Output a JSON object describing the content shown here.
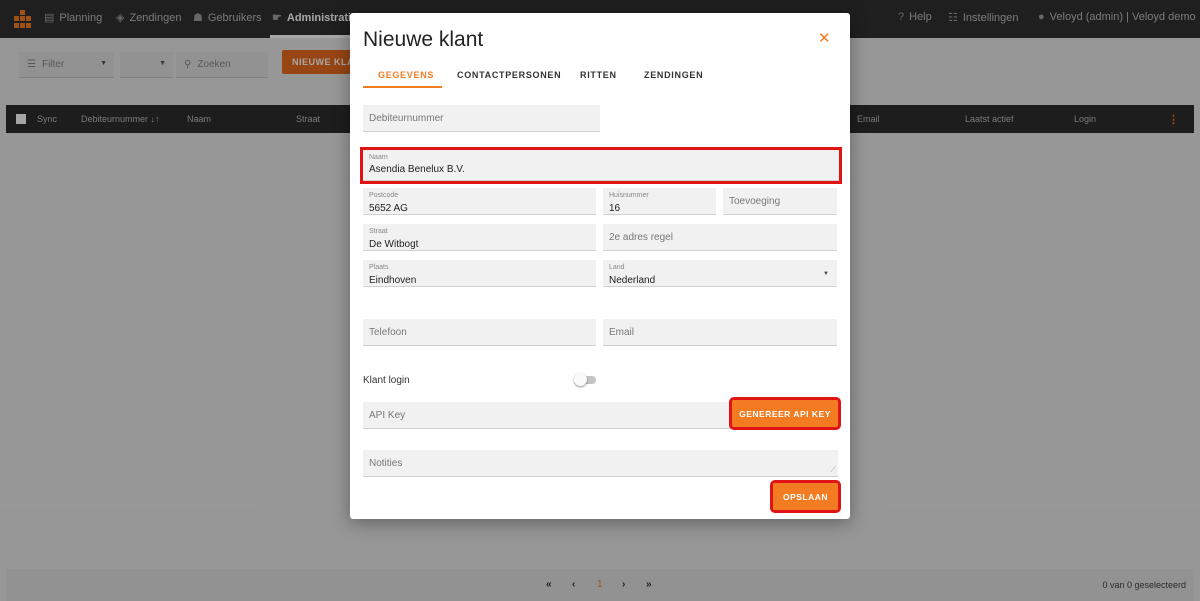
{
  "topbar": {
    "nav": [
      {
        "icon": "planning-icon",
        "glyph": "▤",
        "label": "Planning"
      },
      {
        "icon": "package-icon",
        "glyph": "◈",
        "label": "Zendingen"
      },
      {
        "icon": "users-icon",
        "glyph": "☗",
        "label": "Gebruikers"
      },
      {
        "icon": "administration-icon",
        "glyph": "☛",
        "label": "Administratie"
      }
    ],
    "help_label": "Help",
    "settings_label": "Instellingen",
    "user_label": "Veloyd (admin) | Veloyd demo"
  },
  "toolbar": {
    "filter_label": "Filter",
    "second_select_value": "",
    "search_placeholder": "Zoeken",
    "new_button_label": "NIEUWE KLANT"
  },
  "table": {
    "columns": [
      "Sync",
      "Debiteurnummer ↓↑",
      "Naam",
      "Straat",
      "Email",
      "Laatst actief",
      "Login"
    ]
  },
  "pagination": {
    "first": "«",
    "prev": "‹",
    "page": "1",
    "next": "›",
    "last": "»",
    "selected_text": "0 van 0 geselecteerd"
  },
  "dialog": {
    "title": "Nieuwe klant",
    "close_glyph": "✕",
    "tabs": [
      "GEGEVENS",
      "CONTACTPERSONEN",
      "RITTEN",
      "ZENDINGEN"
    ],
    "active_tab": "GEGEVENS",
    "fields": {
      "debiteurnummer": {
        "placeholder": "Debiteurnummer"
      },
      "naam": {
        "label": "Naam",
        "value": "Asendia Benelux B.V."
      },
      "postcode": {
        "label": "Postcode",
        "value": "5652 AG"
      },
      "huisnummer": {
        "label": "Huisnummer",
        "value": "16"
      },
      "toevoeging": {
        "placeholder": "Toevoeging"
      },
      "straat": {
        "label": "Straat",
        "value": "De Witbogt"
      },
      "adres2": {
        "placeholder": "2e adres regel"
      },
      "plaats": {
        "label": "Plaats",
        "value": "Eindhoven"
      },
      "land": {
        "label": "Land",
        "value": "Nederland"
      },
      "telefoon": {
        "placeholder": "Telefoon"
      },
      "email": {
        "placeholder": "Email"
      },
      "api_key": {
        "placeholder": "API Key"
      },
      "notities": {
        "placeholder": "Notities"
      }
    },
    "klant_login_label": "Klant login",
    "klant_login_enabled": false,
    "generate_api_key_label": "GENEREER API KEY",
    "save_label": "OPSLAAN"
  },
  "colors": {
    "accent": "#f37b21",
    "highlight": "#e01414",
    "topbar": "#303030"
  }
}
